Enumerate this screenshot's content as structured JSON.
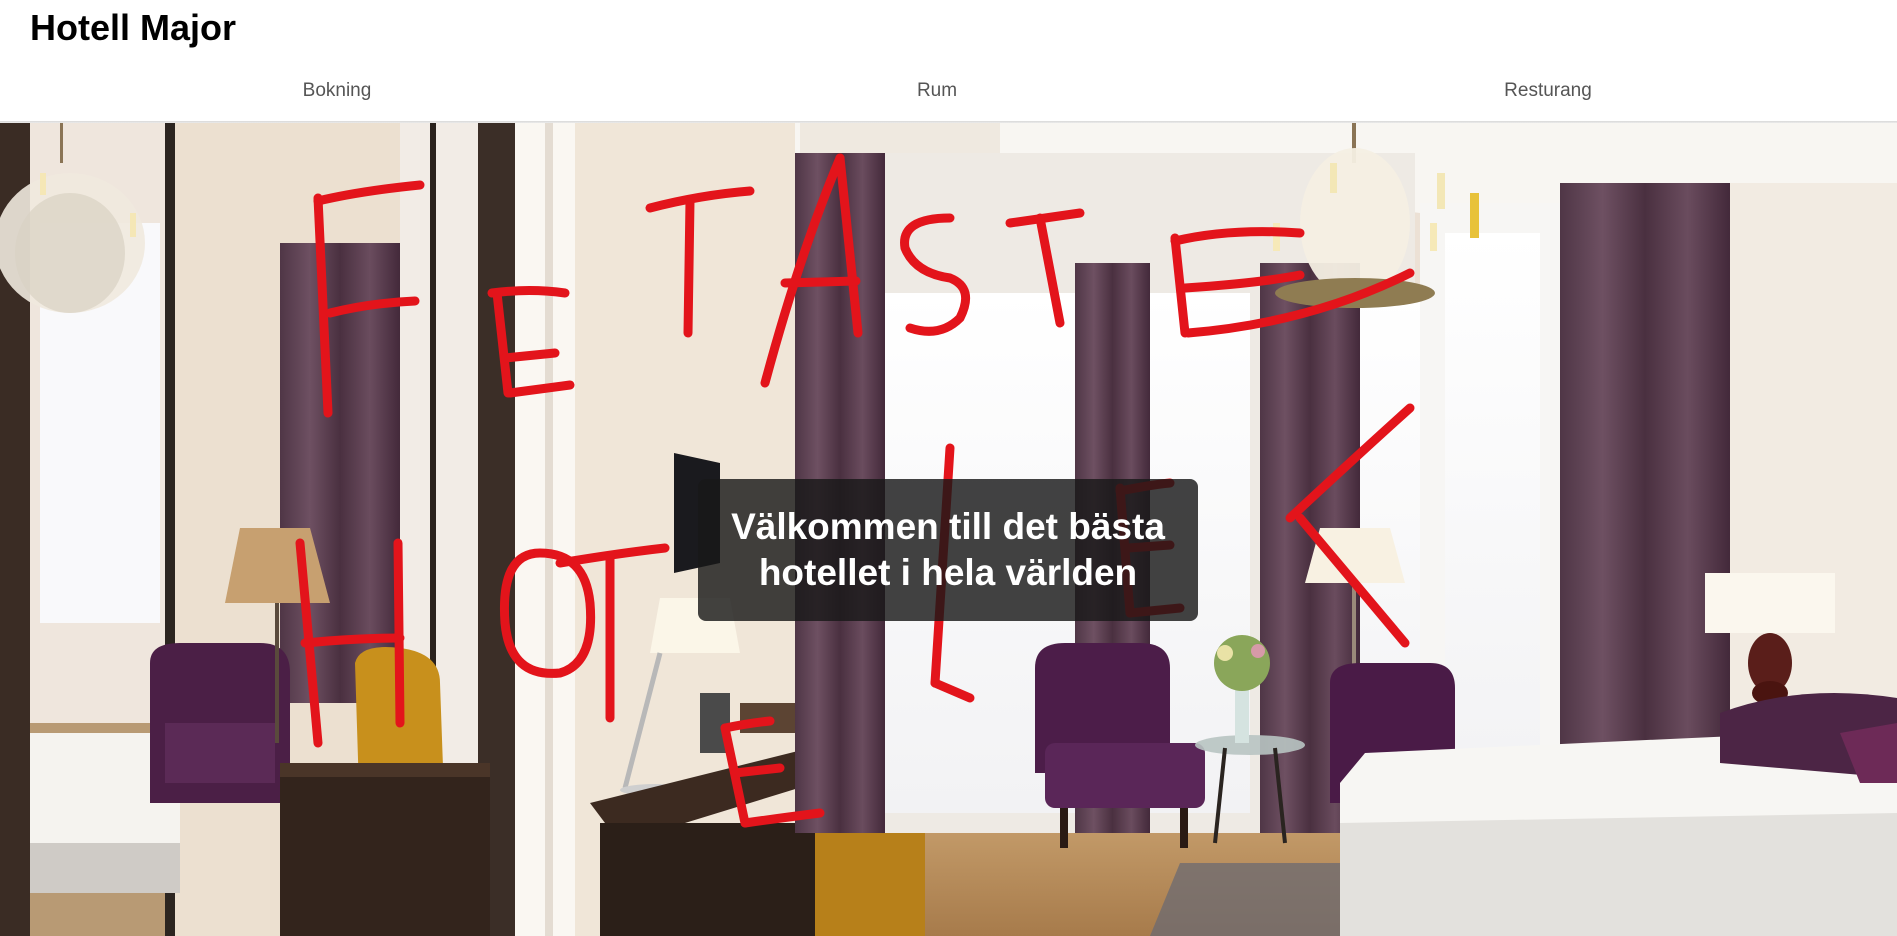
{
  "header": {
    "title": "Hotell Major"
  },
  "nav": {
    "items": [
      {
        "label": "Bokning"
      },
      {
        "label": "Rum"
      },
      {
        "label": "Resturang"
      }
    ]
  },
  "hero": {
    "welcome_text": "Välkommen till det bästa hotellet i hela världen",
    "scribble_text": "FETASTE HOTELLET",
    "scribble_color": "#e3141b"
  }
}
